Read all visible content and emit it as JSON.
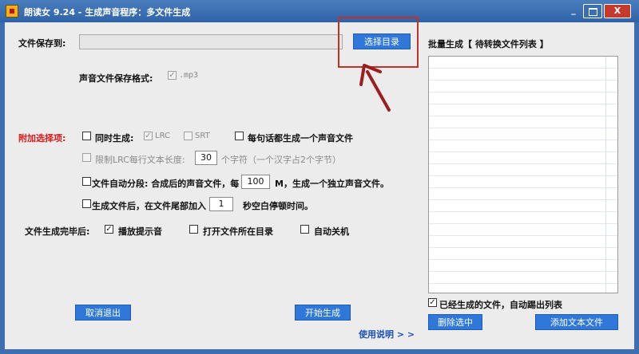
{
  "window": {
    "title": "朗读女 9.24 - 生成声音程序：多文件生成",
    "minimize_label": "_",
    "close_label": "X"
  },
  "output": {
    "save_to_label": "文件保存到:",
    "path_value": "",
    "choose_dir_label": "选择目录",
    "format_label": "声音文件保存格式:",
    "format_check": "✓",
    "format_value": ".mp3"
  },
  "options": {
    "section_label": "附加选择项:",
    "sync_label": "同时生成:",
    "lrc_check": "✓",
    "lrc_label": "LRC",
    "srt_label": "SRT",
    "per_sentence_label": "每句话都生成一个声音文件",
    "limit_lrc_label": "限制LRC每行文本长度:",
    "limit_lrc_value": "30",
    "limit_lrc_suffix": "个字符（一个汉字占2个字节）",
    "auto_split_label": "文件自动分段: 合成后的声音文件，每",
    "auto_split_value": "100",
    "auto_split_suffix": "M，生成一个独立声音文件。",
    "append_silence_label": "生成文件后，在文件尾部加入",
    "append_silence_value": "1",
    "append_silence_suffix": "秒空白停顿时间。"
  },
  "after_complete": {
    "label": "文件生成完毕后:",
    "play_check": "✓",
    "play_label": "播放提示音",
    "open_dir_label": "打开文件所在目录",
    "shutdown_label": "自动关机"
  },
  "batch": {
    "title": "批量生成【 待转换文件列表 】",
    "remove_done_check": "✓",
    "remove_done_label": "已经生成的文件，自动踢出列表",
    "delete_selected_label": "删除选中",
    "add_text_label": "添加文本文件"
  },
  "footer": {
    "cancel_label": "取消退出",
    "start_label": "开始生成",
    "help_link": "使用说明 > >"
  },
  "colors": {
    "button_blue": "#2f78da",
    "highlight_red": "#c0312a",
    "label_red": "#d81a1a"
  }
}
